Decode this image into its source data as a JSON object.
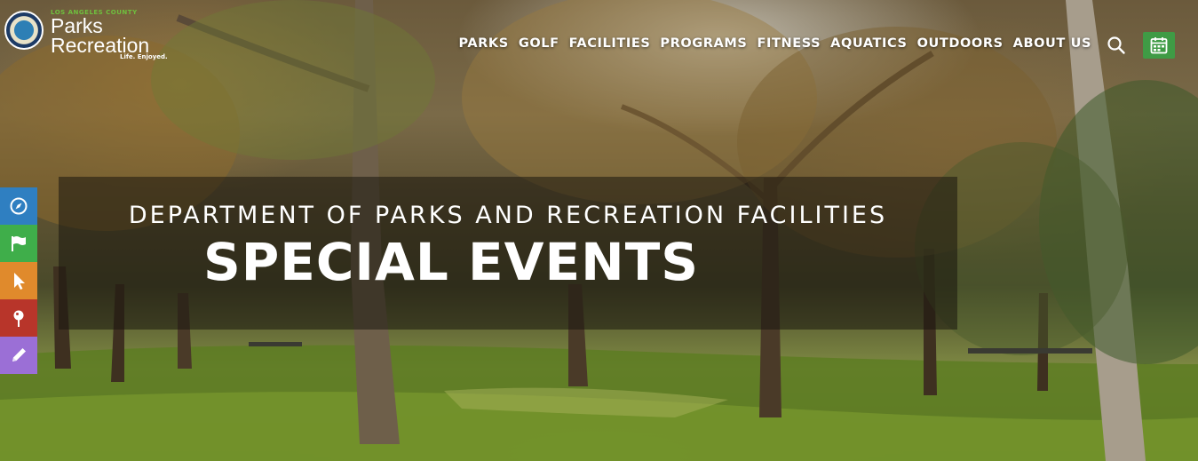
{
  "logo": {
    "top_text": "LOS ANGELES COUNTY",
    "line1": "Parks",
    "line2": "Recreation",
    "tagline": "Life. Enjoyed."
  },
  "nav": {
    "items": [
      {
        "label": "PARKS"
      },
      {
        "label": "GOLF"
      },
      {
        "label": "FACILITIES"
      },
      {
        "label": "PROGRAMS"
      },
      {
        "label": "FITNESS"
      },
      {
        "label": "AQUATICS"
      },
      {
        "label": "OUTDOORS"
      },
      {
        "label": "ABOUT US"
      }
    ],
    "search_icon": "search-icon",
    "calendar_icon": "calendar-icon"
  },
  "side_toolbar": [
    {
      "icon": "compass-icon",
      "color": "#2f7fc1"
    },
    {
      "icon": "flag-icon",
      "color": "#3fae4a"
    },
    {
      "icon": "cursor-icon",
      "color": "#e08a2c"
    },
    {
      "icon": "map-pin-icon",
      "color": "#b8352a"
    },
    {
      "icon": "pencil-icon",
      "color": "#9b6fd6"
    }
  ],
  "banner": {
    "subtitle": "DEPARTMENT OF PARKS AND RECREATION FACILITIES",
    "title": "SPECIAL EVENTS"
  },
  "colors": {
    "calendar_button": "#3f9b45",
    "banner_overlay": "rgba(25,22,15,0.55)"
  }
}
